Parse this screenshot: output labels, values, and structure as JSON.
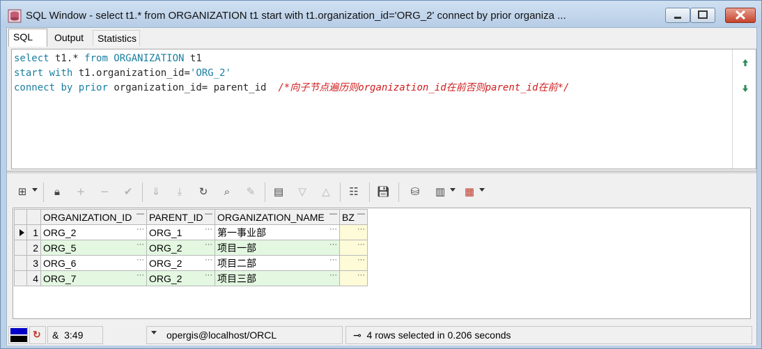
{
  "window": {
    "title": "SQL Window - select t1.* from ORGANIZATION t1 start with t1.organization_id='ORG_2' connect by prior organiza ..."
  },
  "tabs": [
    {
      "label": "SQL"
    },
    {
      "label": "Output"
    },
    {
      "label": "Statistics"
    }
  ],
  "editor": {
    "line1": {
      "kw1": "select",
      "mid": " t1.* ",
      "kw2": "from",
      "tbl": " ORGANIZATION ",
      "alias": "t1"
    },
    "line2": {
      "kw1": "start",
      "sp": " ",
      "kw2": "with",
      "rest": " t1.organization_id=",
      "str": "'ORG_2'"
    },
    "line3": {
      "kw1": "connect",
      "kw2": "by",
      "kw3": "prior",
      "rest": " organization_id= parent_id  ",
      "comment": "/*向子节点遍历则organization_id在前否则parent_id在前*/"
    }
  },
  "grid": {
    "columns": [
      "ORGANIZATION_ID",
      "PARENT_ID",
      "ORGANIZATION_NAME",
      "BZ"
    ],
    "rows": [
      {
        "num": "1",
        "organization_id": "ORG_2",
        "parent_id": "ORG_1",
        "organization_name": "第一事业部",
        "bz": ""
      },
      {
        "num": "2",
        "organization_id": "ORG_5",
        "parent_id": "ORG_2",
        "organization_name": "项目一部",
        "bz": ""
      },
      {
        "num": "3",
        "organization_id": "ORG_6",
        "parent_id": "ORG_2",
        "organization_name": "项目二部",
        "bz": ""
      },
      {
        "num": "4",
        "organization_id": "ORG_7",
        "parent_id": "ORG_2",
        "organization_name": "项目三部",
        "bz": ""
      }
    ],
    "ellipsis": "···"
  },
  "statusbar": {
    "cursor": "3:49",
    "amp": "&",
    "connection": "opergis@localhost/ORCL",
    "result": "4 rows selected in 0.206 seconds"
  },
  "colors": {
    "keyword": "#1a7ea0",
    "comment": "#d01c1c",
    "row_even": "#e3f7e1",
    "bz_cell": "#fdfbd8"
  }
}
